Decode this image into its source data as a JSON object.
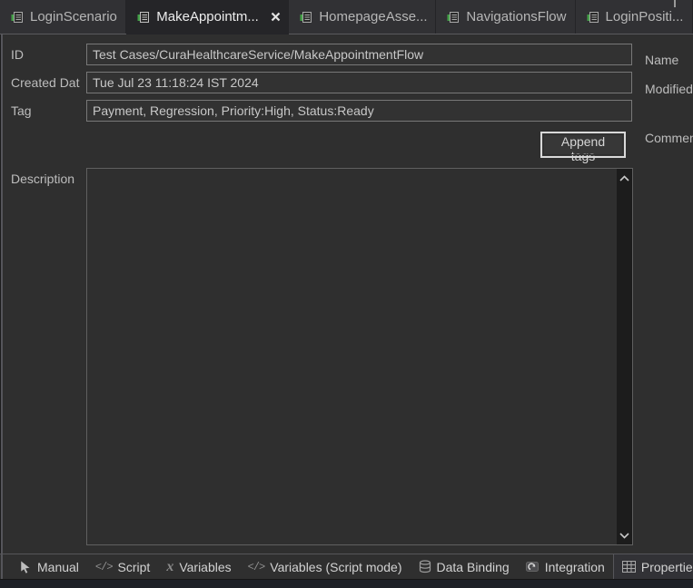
{
  "colors": {
    "background": "#2f2f2f",
    "active_tab_background": "#252528",
    "accent_green": "#43a047",
    "input_border": "#787878",
    "scrollbar_track": "#1c1c1c",
    "bottom_strip": "#1e2127"
  },
  "editor_tabs": {
    "items": [
      {
        "label": "LoginScenario",
        "active": false
      },
      {
        "label": "MakeAppointm...",
        "active": true,
        "closable": true
      },
      {
        "label": "HomepageAsse...",
        "active": false
      },
      {
        "label": "NavigationsFlow",
        "active": false
      },
      {
        "label": "LoginPositi...",
        "active": false
      }
    ]
  },
  "properties_form": {
    "id_label": "ID",
    "id_value": "Test Cases/CuraHealthcareService/MakeAppointmentFlow",
    "created_date_label": "Created Dat",
    "created_date_value": "Tue Jul 23 11:18:24 IST 2024",
    "tag_label": "Tag",
    "tag_value": "Payment, Regression, Priority:High, Status:Ready",
    "append_tags_button": "Append tags",
    "name_label": "Name",
    "modified_label": "Modified",
    "comment_label": "Comment",
    "description_label": "Description",
    "description_value": ""
  },
  "view_tabs": {
    "active": "Properties",
    "items": [
      {
        "label": "Manual",
        "icon": "cursor-icon"
      },
      {
        "label": "Script",
        "icon": "code-icon"
      },
      {
        "label": "Variables",
        "icon": "variable-icon"
      },
      {
        "label": "Variables (Script mode)",
        "icon": "code-icon"
      },
      {
        "label": "Data Binding",
        "icon": "database-icon"
      },
      {
        "label": "Integration",
        "icon": "integration-icon"
      },
      {
        "label": "Properties",
        "icon": "table-icon"
      }
    ]
  },
  "icon_glyphs": {
    "code": "</>",
    "variable": "x"
  }
}
